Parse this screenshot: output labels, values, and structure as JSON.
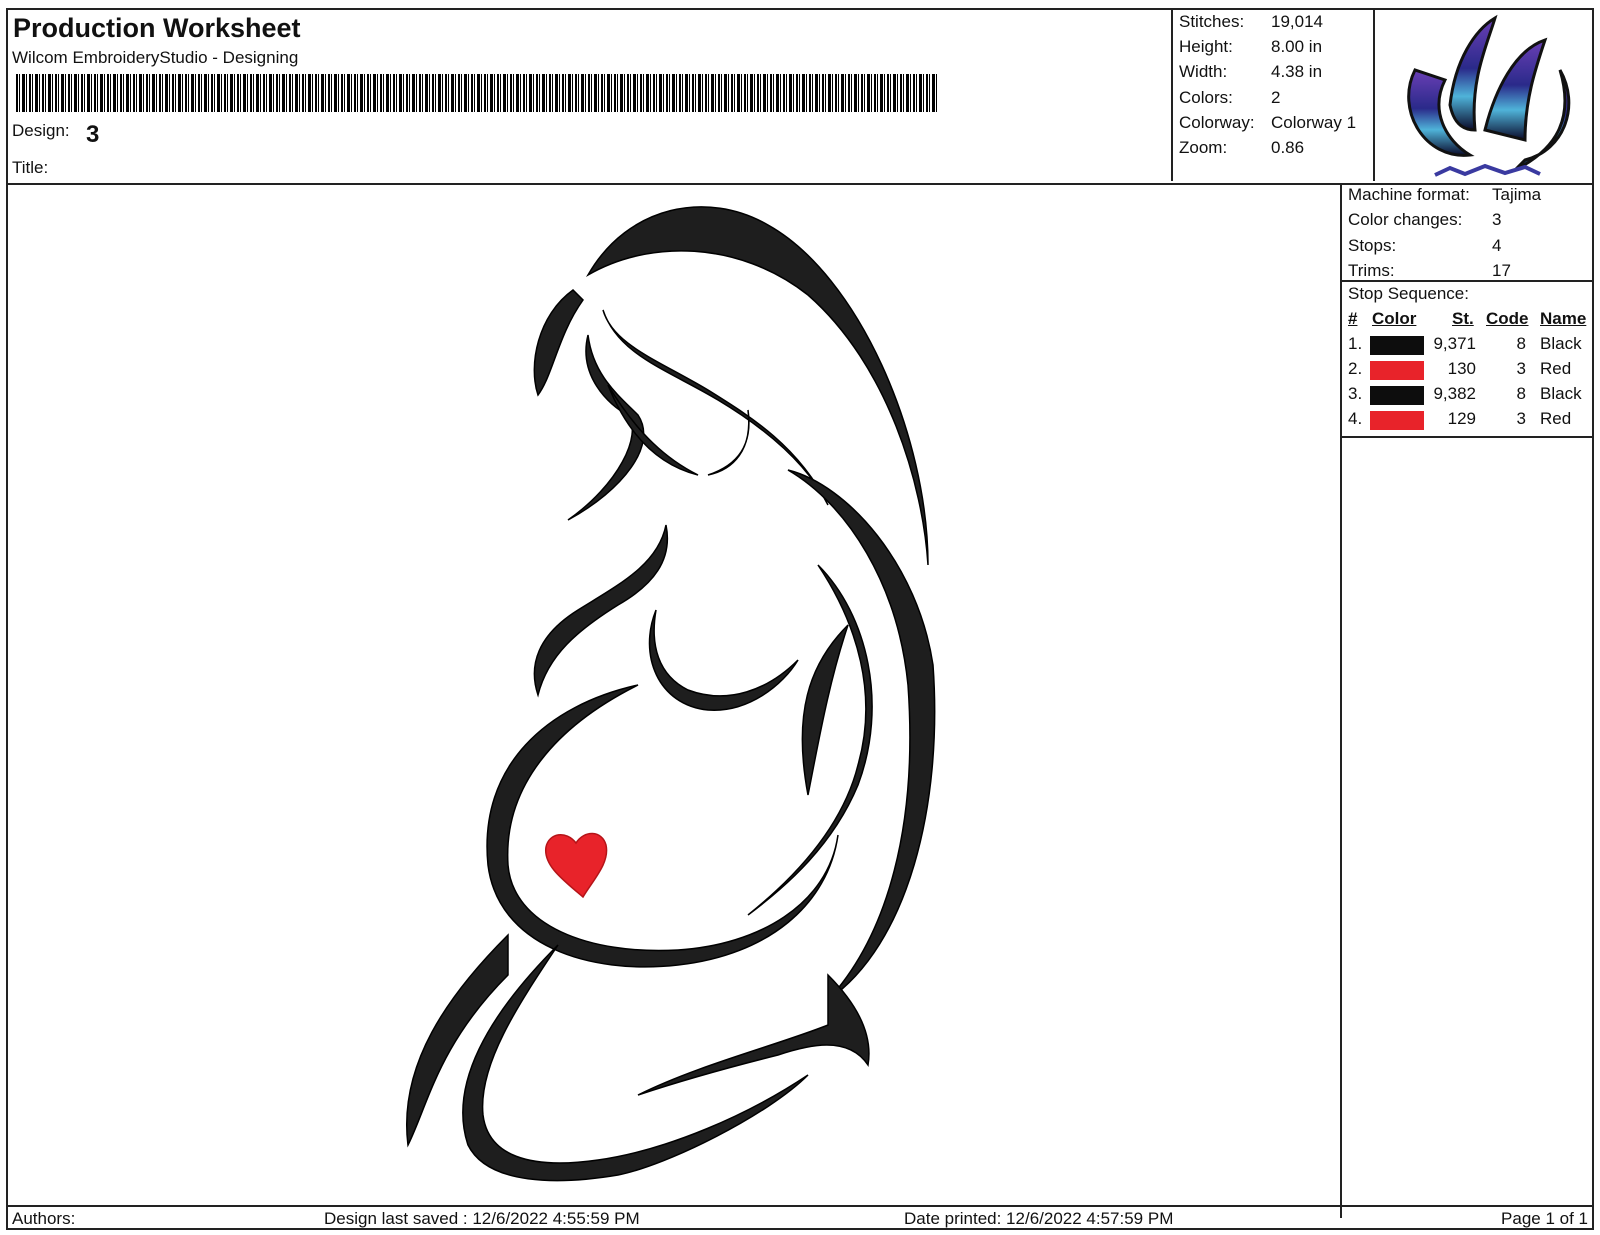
{
  "header": {
    "title": "Production Worksheet",
    "subtitle": "Wilcom EmbroideryStudio - Designing",
    "design_label": "Design:",
    "design_value": "3",
    "title_label": "Title:"
  },
  "stats": [
    {
      "label": "Stitches:",
      "value": "19,014"
    },
    {
      "label": "Height:",
      "value": "8.00 in"
    },
    {
      "label": "Width:",
      "value": "4.38 in"
    },
    {
      "label": "Colors:",
      "value": "2"
    },
    {
      "label": "Colorway:",
      "value": "Colorway 1"
    },
    {
      "label": "Zoom:",
      "value": "0.86"
    }
  ],
  "machine": [
    {
      "label": "Machine format:",
      "value": "Tajima"
    },
    {
      "label": "Color changes:",
      "value": "3"
    },
    {
      "label": "Stops:",
      "value": "4"
    },
    {
      "label": "Trims:",
      "value": "17"
    }
  ],
  "stop_sequence": {
    "title": "Stop Sequence:",
    "headers": {
      "num": "#",
      "color": "Color",
      "st": "St.",
      "code": "Code",
      "name": "Name"
    },
    "rows": [
      {
        "num": "1.",
        "swatch": "#0d0d0d",
        "st": "9,371",
        "code": "8",
        "name": "Black"
      },
      {
        "num": "2.",
        "swatch": "#e8232a",
        "st": "130",
        "code": "3",
        "name": "Red"
      },
      {
        "num": "3.",
        "swatch": "#0d0d0d",
        "st": "9,382",
        "code": "8",
        "name": "Black"
      },
      {
        "num": "4.",
        "swatch": "#e8232a",
        "st": "129",
        "code": "3",
        "name": "Red"
      }
    ]
  },
  "footer": {
    "authors": "Authors:",
    "last_saved": "Design last saved : 12/6/2022 4:55:59 PM",
    "date_printed": "Date printed: 12/6/2022 4:57:59 PM",
    "page": "Page 1 of 1"
  },
  "colors": {
    "thread_black": "#1a1a1a",
    "thread_red": "#e8232a",
    "logo_blue": "#3a3aa0"
  }
}
